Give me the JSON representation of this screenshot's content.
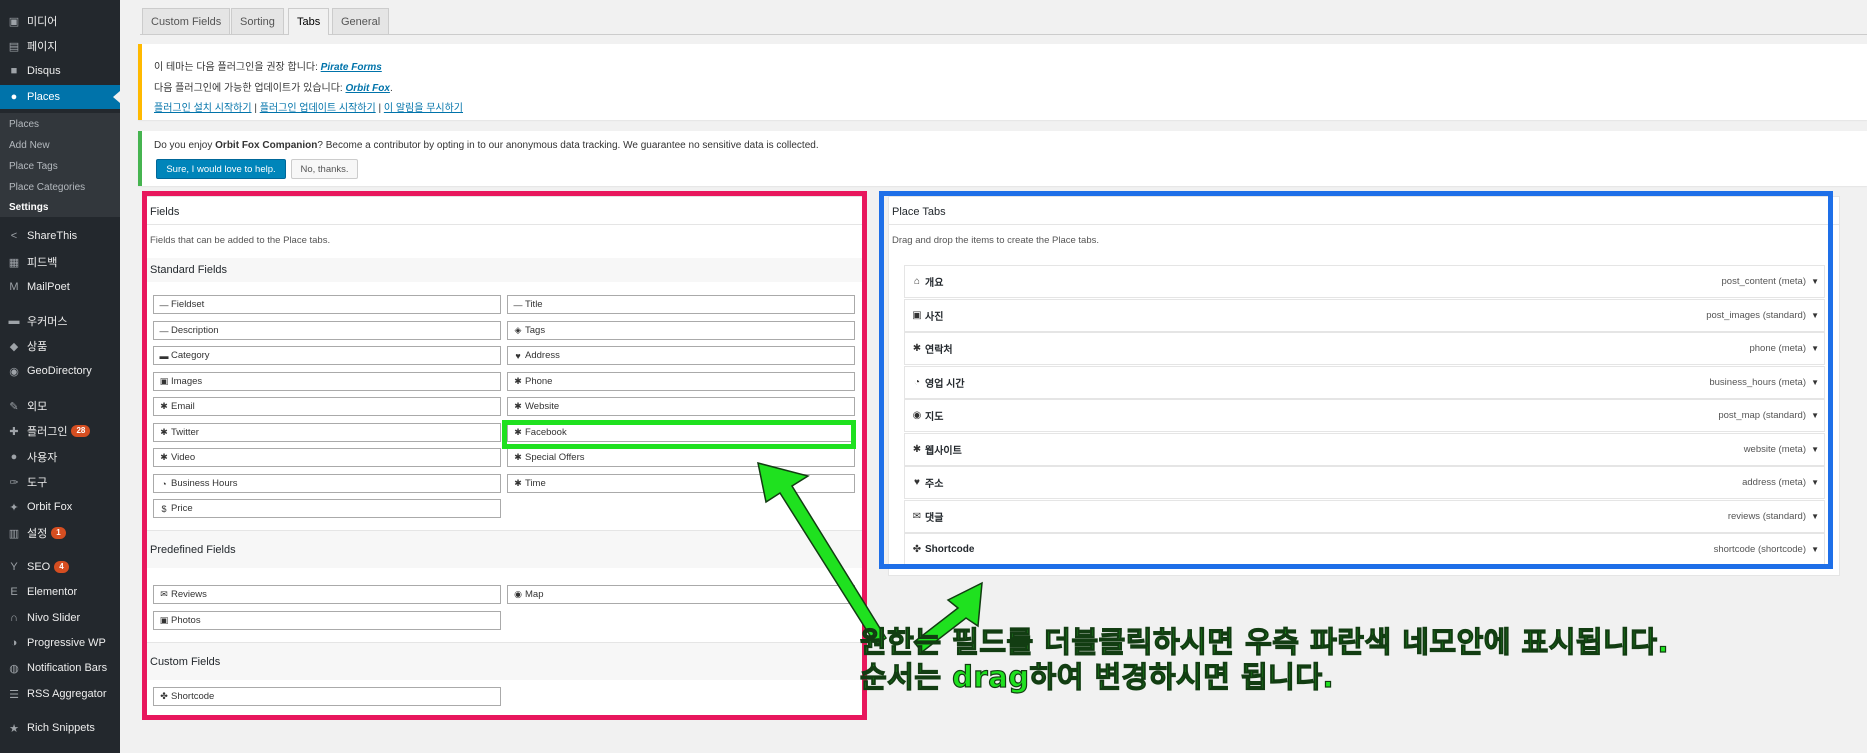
{
  "sidebar": {
    "items": [
      {
        "label": "미디어",
        "icon": "media-icon"
      },
      {
        "label": "페이지",
        "icon": "page-icon"
      },
      {
        "label": "Disqus",
        "icon": "comment-icon"
      },
      {
        "label": "Places",
        "icon": "pin-icon"
      },
      {
        "label": "ShareThis",
        "icon": "share-icon"
      },
      {
        "label": "피드백",
        "icon": "feedback-icon"
      },
      {
        "label": "MailPoet",
        "icon": "mail-icon"
      },
      {
        "label": "우커머스",
        "icon": "woocommerce-icon"
      },
      {
        "label": "상품",
        "icon": "product-icon"
      },
      {
        "label": "GeoDirectory",
        "icon": "globe-icon"
      },
      {
        "label": "외모",
        "icon": "brush-icon"
      },
      {
        "label": "플러그인",
        "icon": "plugin-icon",
        "badge": "28"
      },
      {
        "label": "사용자",
        "icon": "user-icon"
      },
      {
        "label": "도구",
        "icon": "wrench-icon"
      },
      {
        "label": "Orbit Fox",
        "icon": "fox-icon"
      },
      {
        "label": "설정",
        "icon": "settings-icon",
        "badge": "1"
      },
      {
        "label": "SEO",
        "icon": "seo-icon",
        "badge": "4"
      },
      {
        "label": "Elementor",
        "icon": "elementor-icon"
      },
      {
        "label": "Nivo Slider",
        "icon": "slider-icon"
      },
      {
        "label": "Progressive WP",
        "icon": "progressive-icon"
      },
      {
        "label": "Notification Bars",
        "icon": "bell-icon"
      },
      {
        "label": "RSS Aggregator",
        "icon": "rss-icon"
      },
      {
        "label": "Rich Snippets",
        "icon": "star-icon"
      }
    ],
    "submenu": [
      "Places",
      "Add New",
      "Place Tags",
      "Place Categories",
      "Settings"
    ]
  },
  "tabs": [
    "Custom Fields",
    "Sorting",
    "Tabs",
    "General"
  ],
  "notice1": {
    "line1_prefix": "이 테마는 다음 플러그인을 권장 합니다: ",
    "line1_link": "Pirate Forms",
    "line2_prefix": "다음 플러그인에 가능한 업데이트가 있습니다: ",
    "line2_link": "Orbit Fox",
    "line2_suffix": ".",
    "action1": "플러그인 설치 시작하기",
    "action2": "플러그인 업데이트 시작하기",
    "action3": "이 알림을 무시하기",
    "separator": " | "
  },
  "notice2": {
    "text_prefix": "Do you enjoy ",
    "text_bold": "Orbit Fox Companion",
    "text_suffix": "? Become a contributor by opting in to our anonymous data tracking. We guarantee no sensitive data is collected.",
    "accept": "Sure, I would love to help.",
    "decline": "No, thanks."
  },
  "fields_panel": {
    "title": "Fields",
    "description": "Fields that can be added to the Place tabs.",
    "standard_title": "Standard Fields",
    "standard_left": [
      {
        "label": "Fieldset",
        "icon": "minus-icon"
      },
      {
        "label": "Description",
        "icon": "minus-icon"
      },
      {
        "label": "Category",
        "icon": "folder-icon"
      },
      {
        "label": "Images",
        "icon": "image-icon"
      },
      {
        "label": "Email",
        "icon": "gear-icon"
      },
      {
        "label": "Twitter",
        "icon": "gear-icon"
      },
      {
        "label": "Video",
        "icon": "gear-icon"
      },
      {
        "label": "Business Hours",
        "icon": "clock-icon"
      },
      {
        "label": "Price",
        "icon": "dollar-icon"
      }
    ],
    "standard_right": [
      {
        "label": "Title",
        "icon": "minus-icon"
      },
      {
        "label": "Tags",
        "icon": "tags-icon"
      },
      {
        "label": "Address",
        "icon": "pin-icon"
      },
      {
        "label": "Phone",
        "icon": "gear-icon"
      },
      {
        "label": "Website",
        "icon": "gear-icon"
      },
      {
        "label": "Facebook",
        "icon": "gear-icon"
      },
      {
        "label": "Special Offers",
        "icon": "gear-icon"
      },
      {
        "label": "Time",
        "icon": "gear-icon"
      }
    ],
    "predefined_title": "Predefined Fields",
    "predefined": [
      {
        "label": "Reviews",
        "icon": "comments-icon"
      },
      {
        "label": "Map",
        "icon": "globe-icon"
      },
      {
        "label": "Photos",
        "icon": "image-icon"
      }
    ],
    "custom_title": "Custom Fields",
    "custom": [
      {
        "label": "Shortcode",
        "icon": "cubes-icon"
      }
    ]
  },
  "tabs_panel": {
    "title": "Place Tabs",
    "description": "Drag and drop the items to create the Place tabs.",
    "items": [
      {
        "label": "개요",
        "meta": "post_content (meta)",
        "icon": "home-icon"
      },
      {
        "label": "사진",
        "meta": "post_images (standard)",
        "icon": "image-icon"
      },
      {
        "label": "연락처",
        "meta": "phone (meta)",
        "icon": "gear-icon"
      },
      {
        "label": "영업 시간",
        "meta": "business_hours (meta)",
        "icon": "clock-icon"
      },
      {
        "label": "지도",
        "meta": "post_map (standard)",
        "icon": "globe-icon"
      },
      {
        "label": "웹사이트",
        "meta": "website (meta)",
        "icon": "gear-icon"
      },
      {
        "label": "주소",
        "meta": "address (meta)",
        "icon": "pin-icon"
      },
      {
        "label": "댓글",
        "meta": "reviews (standard)",
        "icon": "comments-icon"
      },
      {
        "label": "Shortcode",
        "meta": "shortcode (shortcode)",
        "icon": "cubes-icon"
      }
    ]
  },
  "annotation": {
    "line1": "원한는 필드를 더블클릭하시면 우측 파란색 네모안에 표시됩니다.",
    "line2": "순서는 drag하여 변경하시면 됩니다.",
    "colors": {
      "pink": "#e8175d",
      "blue": "#1e6fe8",
      "green": "#1fe11f"
    }
  }
}
